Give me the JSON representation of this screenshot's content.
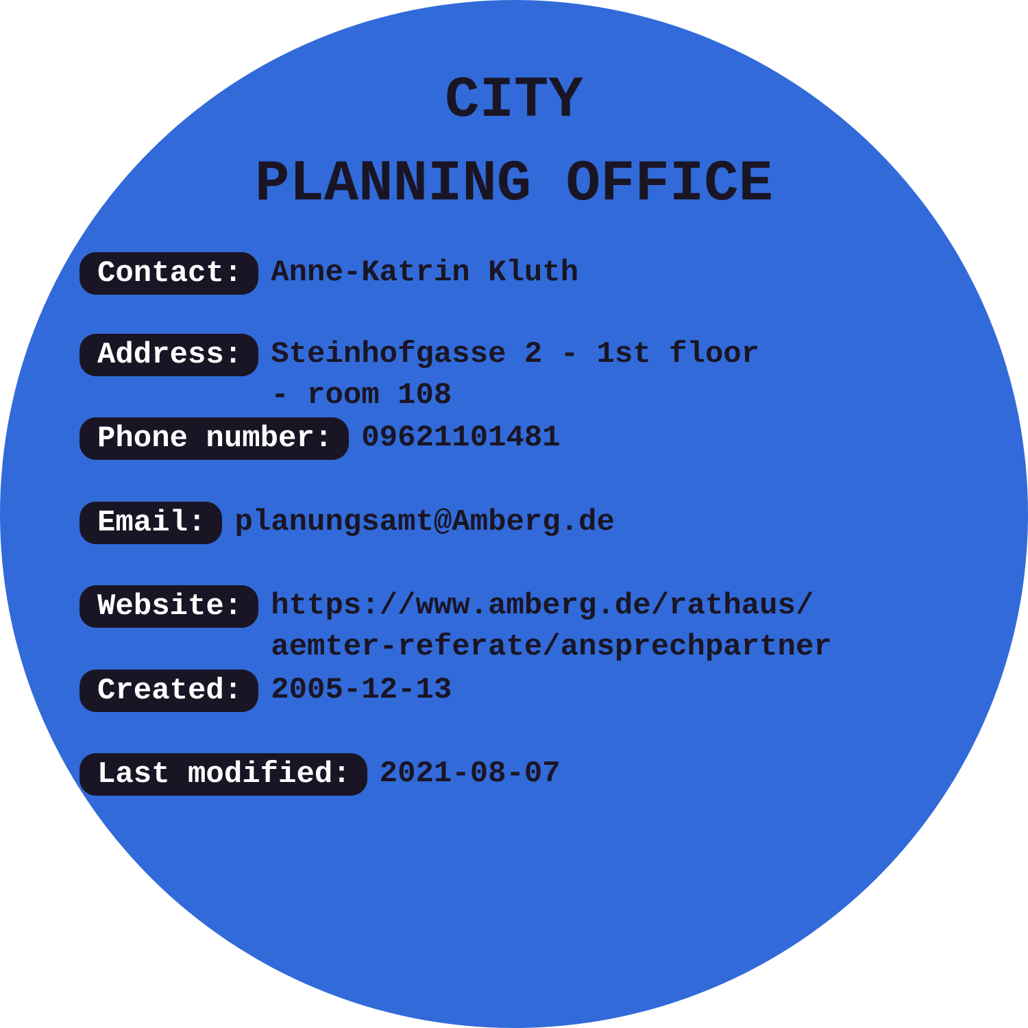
{
  "card": {
    "background_color": "#326bd9",
    "text_color": "#1a1525",
    "title_line1": "CITY",
    "title_line2": "PLANNING OFFICE"
  },
  "fields": {
    "contact": {
      "label": "Contact:",
      "value": "Anne-Katrin Kluth"
    },
    "address": {
      "label": "Address:",
      "value_line1": "Steinhofgasse 2 - 1st floor",
      "value_line2": "- room 108"
    },
    "phone": {
      "label": "Phone number:",
      "value": "09621101481"
    },
    "email": {
      "label": "Email:",
      "value": "planungsamt@Amberg.de"
    },
    "website": {
      "label": "Website:",
      "value_line1": "https://www.amberg.de/rathaus/",
      "value_line2": "aemter-referate/ansprechpartner"
    },
    "created": {
      "label": "Created:",
      "value": "2005-12-13"
    },
    "modified": {
      "label": "Last modified:",
      "value": "2021-08-07"
    }
  }
}
